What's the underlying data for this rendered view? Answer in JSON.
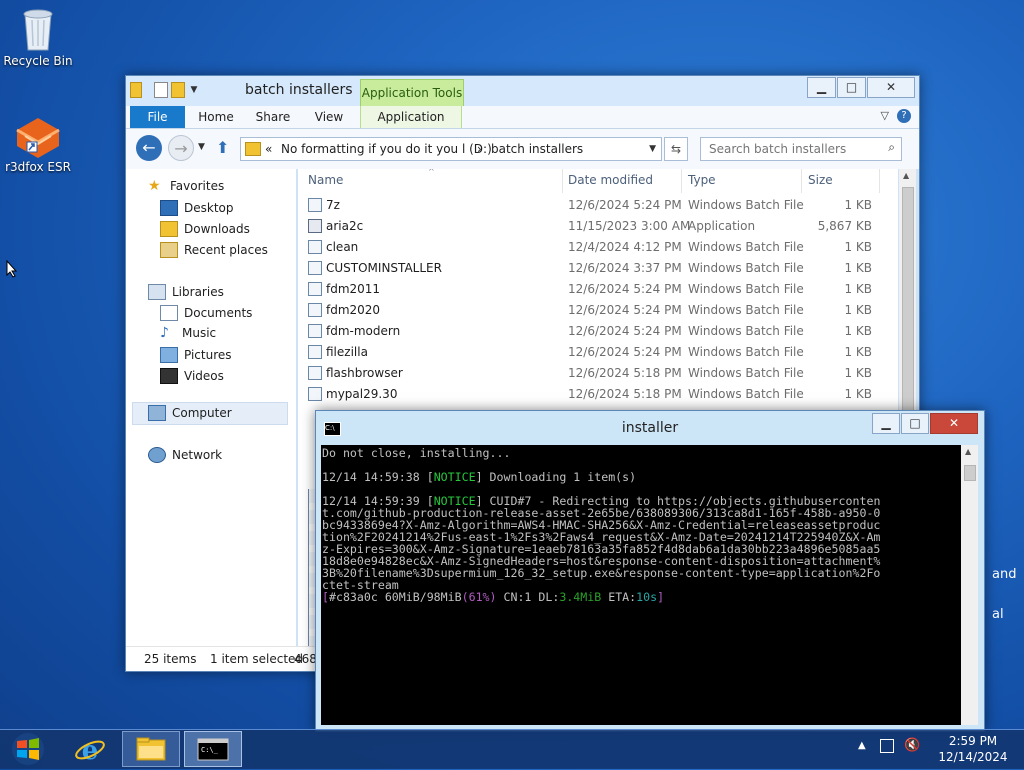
{
  "desktop": {
    "icons": [
      {
        "label": "Recycle Bin",
        "icon": "recycle-bin-icon"
      },
      {
        "label": "r3dfox ESR",
        "icon": "r3dfox-icon"
      }
    ]
  },
  "explorer": {
    "title": "batch installers",
    "context_tab": "Application Tools",
    "tabs": {
      "file": "File",
      "home": "Home",
      "share": "Share",
      "view": "View",
      "application": "Application"
    },
    "address": {
      "prefix": "«",
      "drive": "No formatting if you do it you l (D:)",
      "separator": "›",
      "folder": "batch installers"
    },
    "search_placeholder": "Search batch installers",
    "nav": {
      "favorites": "Favorites",
      "desktop": "Desktop",
      "downloads": "Downloads",
      "recent": "Recent places",
      "libraries": "Libraries",
      "documents": "Documents",
      "music": "Music",
      "pictures": "Pictures",
      "videos": "Videos",
      "computer": "Computer",
      "network": "Network"
    },
    "columns": {
      "name": "Name",
      "date": "Date modified",
      "type": "Type",
      "size": "Size"
    },
    "files": [
      {
        "name": "7z",
        "date": "12/6/2024 5:24 PM",
        "type": "Windows Batch File",
        "size": "1 KB"
      },
      {
        "name": "aria2c",
        "date": "11/15/2023 3:00 AM",
        "type": "Application",
        "size": "5,867 KB"
      },
      {
        "name": "clean",
        "date": "12/4/2024 4:12 PM",
        "type": "Windows Batch File",
        "size": "1 KB"
      },
      {
        "name": "CUSTOMINSTALLER",
        "date": "12/6/2024 3:37 PM",
        "type": "Windows Batch File",
        "size": "1 KB"
      },
      {
        "name": "fdm2011",
        "date": "12/6/2024 5:24 PM",
        "type": "Windows Batch File",
        "size": "1 KB"
      },
      {
        "name": "fdm2020",
        "date": "12/6/2024 5:24 PM",
        "type": "Windows Batch File",
        "size": "1 KB"
      },
      {
        "name": "fdm-modern",
        "date": "12/6/2024 5:24 PM",
        "type": "Windows Batch File",
        "size": "1 KB"
      },
      {
        "name": "filezilla",
        "date": "12/6/2024 5:24 PM",
        "type": "Windows Batch File",
        "size": "1 KB"
      },
      {
        "name": "flashbrowser",
        "date": "12/6/2024 5:18 PM",
        "type": "Windows Batch File",
        "size": "1 KB"
      },
      {
        "name": "mypal29.30",
        "date": "12/6/2024 5:18 PM",
        "type": "Windows Batch File",
        "size": "1 KB"
      }
    ],
    "status": {
      "count": "25 items",
      "selected": "1 item selected",
      "size": "468"
    }
  },
  "console": {
    "title": "installer",
    "icon_text": "C:\\",
    "lines": {
      "l1": "Do not close, installing...",
      "l2_ts": "12/14 14:59:38 [",
      "l2_notice": "NOTICE",
      "l2_msg": "] Downloading 1 item(s)",
      "l3_ts": "12/14 14:59:39 [",
      "l3_notice": "NOTICE",
      "l3_msg": "] CUID#7 - Redirecting to https://objects.githubuserconten",
      "w1": "t.com/github-production-release-asset-2e65be/638089306/313ca8d1-165f-458b-a950-0",
      "w2": "bc9433869e4?X-Amz-Algorithm=AWS4-HMAC-SHA256&X-Amz-Credential=releaseassetproduc",
      "w3": "tion%2F20241214%2Fus-east-1%2Fs3%2Faws4_request&X-Amz-Date=20241214T225940Z&X-Am",
      "w4": "z-Expires=300&X-Amz-Signature=1eaeb78163a35fa852f4d8dab6a1da30bb223a4896e5085aa5",
      "w5": "18d8e0e94828ec&X-Amz-SignedHeaders=host&response-content-disposition=attachment%",
      "w6": "3B%20filename%3Dsupermium_126_32_setup.exe&response-content-type=application%2Fo",
      "w7": "ctet-stream",
      "p_open": "[",
      "p_id": "#c83a0c 60MiB/98MiB",
      "p_pct": "(61%)",
      "p_cn": " CN:1 DL:",
      "p_dl": "3.4MiB",
      "p_eta": " ETA:",
      "p_eta_val": "10s",
      "p_close": "]"
    }
  },
  "taskbar": {
    "time": "2:59 PM",
    "date": "12/14/2024"
  },
  "desktop_fragments": {
    "a": "and",
    "b": "al"
  }
}
